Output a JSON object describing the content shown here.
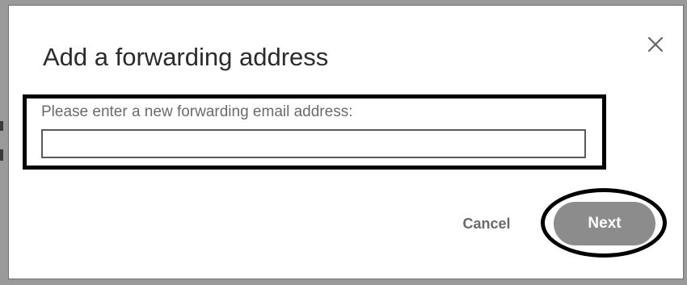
{
  "dialog": {
    "title": "Add a forwarding address",
    "prompt": "Please enter a new forwarding email address:",
    "email_value": "",
    "close_icon": "close-icon"
  },
  "actions": {
    "cancel_label": "Cancel",
    "next_label": "Next"
  },
  "colors": {
    "next_button_bg": "#8c8c8c",
    "annotation": "#000000"
  }
}
